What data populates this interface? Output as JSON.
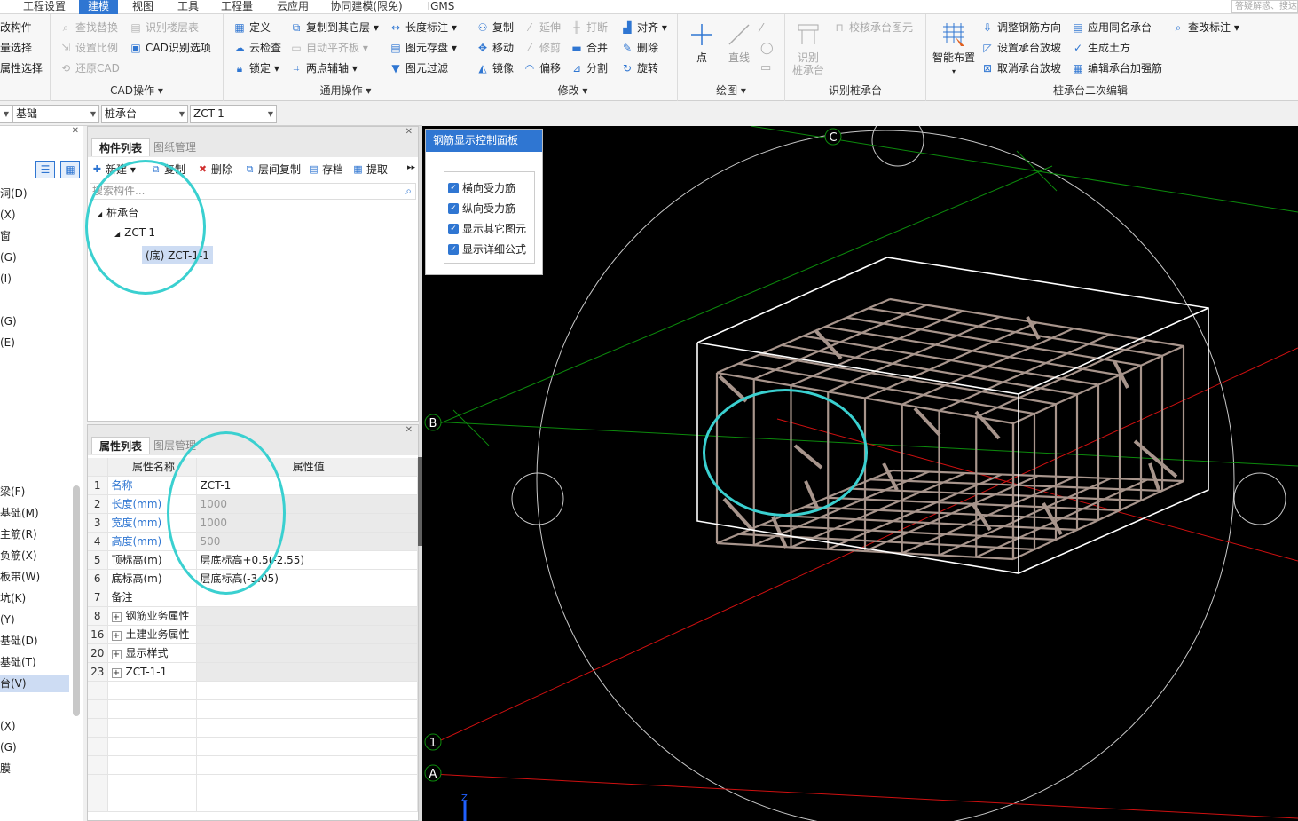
{
  "menubar": {
    "items": [
      "工程设置",
      "建模",
      "视图",
      "工具",
      "工程量",
      "云应用",
      "协同建模(限免)",
      "IGMS"
    ],
    "active_index": 1,
    "search_placeholder": "答疑解惑、搜达"
  },
  "ribbon": {
    "left_partial": [
      "改构件",
      "量选择",
      "属性选择"
    ],
    "cad": {
      "buttons": [
        "查找替换",
        "设置比例",
        "还原CAD",
        "识别楼层表",
        "CAD识别选项"
      ],
      "label": "CAD操作"
    },
    "general": {
      "buttons": [
        "定义",
        "云检查",
        "锁定",
        "复制到其它层",
        "自动平齐板",
        "两点辅轴",
        "长度标注",
        "图元存盘",
        "图元过滤"
      ],
      "label": "通用操作"
    },
    "modify": {
      "buttons": [
        "复制",
        "移动",
        "镜像",
        "延伸",
        "修剪",
        "偏移",
        "打断",
        "合并",
        "分割",
        "对齐",
        "删除",
        "旋转"
      ],
      "label": "修改"
    },
    "draw": {
      "buttons": [
        "点",
        "直线"
      ],
      "label": "绘图"
    },
    "identify": {
      "big_button": "识别\n桩承台",
      "buttons": [
        "校核承台图元"
      ],
      "label": "识别桩承台"
    },
    "secondary": {
      "big_button": "智能布置",
      "buttons": [
        "调整钢筋方向",
        "设置承台放坡",
        "取消承台放坡",
        "应用同名承台",
        "生成土方",
        "编辑承台加强筋",
        "查改标注"
      ],
      "label": "桩承台二次编辑"
    }
  },
  "selectors": [
    "基础",
    "桩承台",
    "ZCT-1"
  ],
  "nav": {
    "items": [
      "洞(D)",
      "(X)",
      "窗",
      "(G)",
      "(I)",
      "",
      "(G)",
      "(E)",
      "梁(F)",
      "基础(M)",
      "主筋(R)",
      "负筋(X)",
      "板带(W)",
      "坑(K)",
      "(Y)",
      "基础(D)",
      "基础(T)",
      "台(V)",
      "",
      "(X)",
      "(G)",
      "膜"
    ],
    "selected_index": 17
  },
  "component_list": {
    "tabs": [
      "构件列表",
      "图纸管理"
    ],
    "toolbar": [
      "新建",
      "复制",
      "删除",
      "层间复制",
      "存档",
      "提取"
    ],
    "search_placeholder": "搜索构件...",
    "tree": {
      "root": "桩承台",
      "child": "ZCT-1",
      "leaf": "(底) ZCT-1-1"
    }
  },
  "properties": {
    "tabs": [
      "属性列表",
      "图层管理"
    ],
    "headers": [
      "属性名称",
      "属性值"
    ],
    "rows": [
      {
        "n": "1",
        "name": "名称",
        "value": "ZCT-1",
        "blue": true,
        "gray": false,
        "plus": false
      },
      {
        "n": "2",
        "name": "长度(mm)",
        "value": "1000",
        "blue": true,
        "gray": true,
        "plus": false
      },
      {
        "n": "3",
        "name": "宽度(mm)",
        "value": "1000",
        "blue": true,
        "gray": true,
        "plus": false
      },
      {
        "n": "4",
        "name": "高度(mm)",
        "value": "500",
        "blue": true,
        "gray": true,
        "plus": false
      },
      {
        "n": "5",
        "name": "顶标高(m)",
        "value": "层底标高+0.5(-2.55)",
        "blue": false,
        "gray": false,
        "plus": false
      },
      {
        "n": "6",
        "name": "底标高(m)",
        "value": "层底标高(-3.05)",
        "blue": false,
        "gray": false,
        "plus": false
      },
      {
        "n": "7",
        "name": "备注",
        "value": "",
        "blue": false,
        "gray": false,
        "plus": false
      },
      {
        "n": "8",
        "name": "钢筋业务属性",
        "value": "",
        "blue": false,
        "gray": true,
        "plus": true
      },
      {
        "n": "16",
        "name": "土建业务属性",
        "value": "",
        "blue": false,
        "gray": true,
        "plus": true
      },
      {
        "n": "20",
        "name": "显示样式",
        "value": "",
        "blue": false,
        "gray": true,
        "plus": true
      },
      {
        "n": "23",
        "name": "ZCT-1-1",
        "value": "",
        "blue": false,
        "gray": true,
        "plus": true
      }
    ]
  },
  "rebar_panel": {
    "title": "钢筋显示控制面板",
    "options": [
      "横向受力筋",
      "纵向受力筋",
      "显示其它图元",
      "显示详细公式"
    ]
  },
  "viewport": {
    "axis_labels": [
      "C",
      "B",
      "1",
      "A"
    ],
    "axis_indicator": "Z"
  },
  "colors": {
    "accent": "#2f76d2",
    "highlight": "#3ad0d0",
    "rebar": "#a8958c",
    "axis_red": "#d01010",
    "axis_green": "#0c8a0c"
  }
}
